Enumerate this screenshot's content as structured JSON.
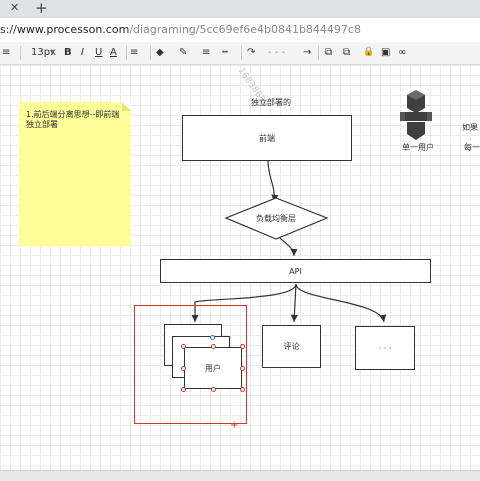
{
  "browser": {
    "close_glyph": "✕",
    "new_tab_glyph": "+",
    "url_prefix": "s://",
    "url_host": "www.processon.com",
    "url_path": "/diagraming/5cc69ef6e4b0841b844497c8"
  },
  "toolbar": {
    "menu_glyph": "≡",
    "font_size": "13px",
    "bold": "B",
    "italic": "I",
    "underline": "U",
    "font_color": "A",
    "align": "≡",
    "fill": "◆",
    "line_color": "✎",
    "line_width": "≡",
    "line_style": "┅",
    "connector": "↷",
    "line_pattern": "- - -",
    "arrow": "→",
    "front": "⧉",
    "back": "⧉",
    "lock": "🔒",
    "group": "▣",
    "link": "∞"
  },
  "diagram": {
    "note_text": "1.前后端分离思想--即前端独立部署",
    "heading_independent": "独立部署的",
    "frontend": "前端",
    "load_balancer": "负载均衡层",
    "api": "API",
    "user": "用户",
    "comment": "评论",
    "more": "· · ·",
    "single_user": "单一用户",
    "side_text_1": "如果",
    "side_text_2": "每一",
    "watermark": "16838698"
  },
  "colors": {
    "selection": "#d9342b",
    "note_bg": "#fdfd9a",
    "aws_icon": "#3f3f3f"
  }
}
